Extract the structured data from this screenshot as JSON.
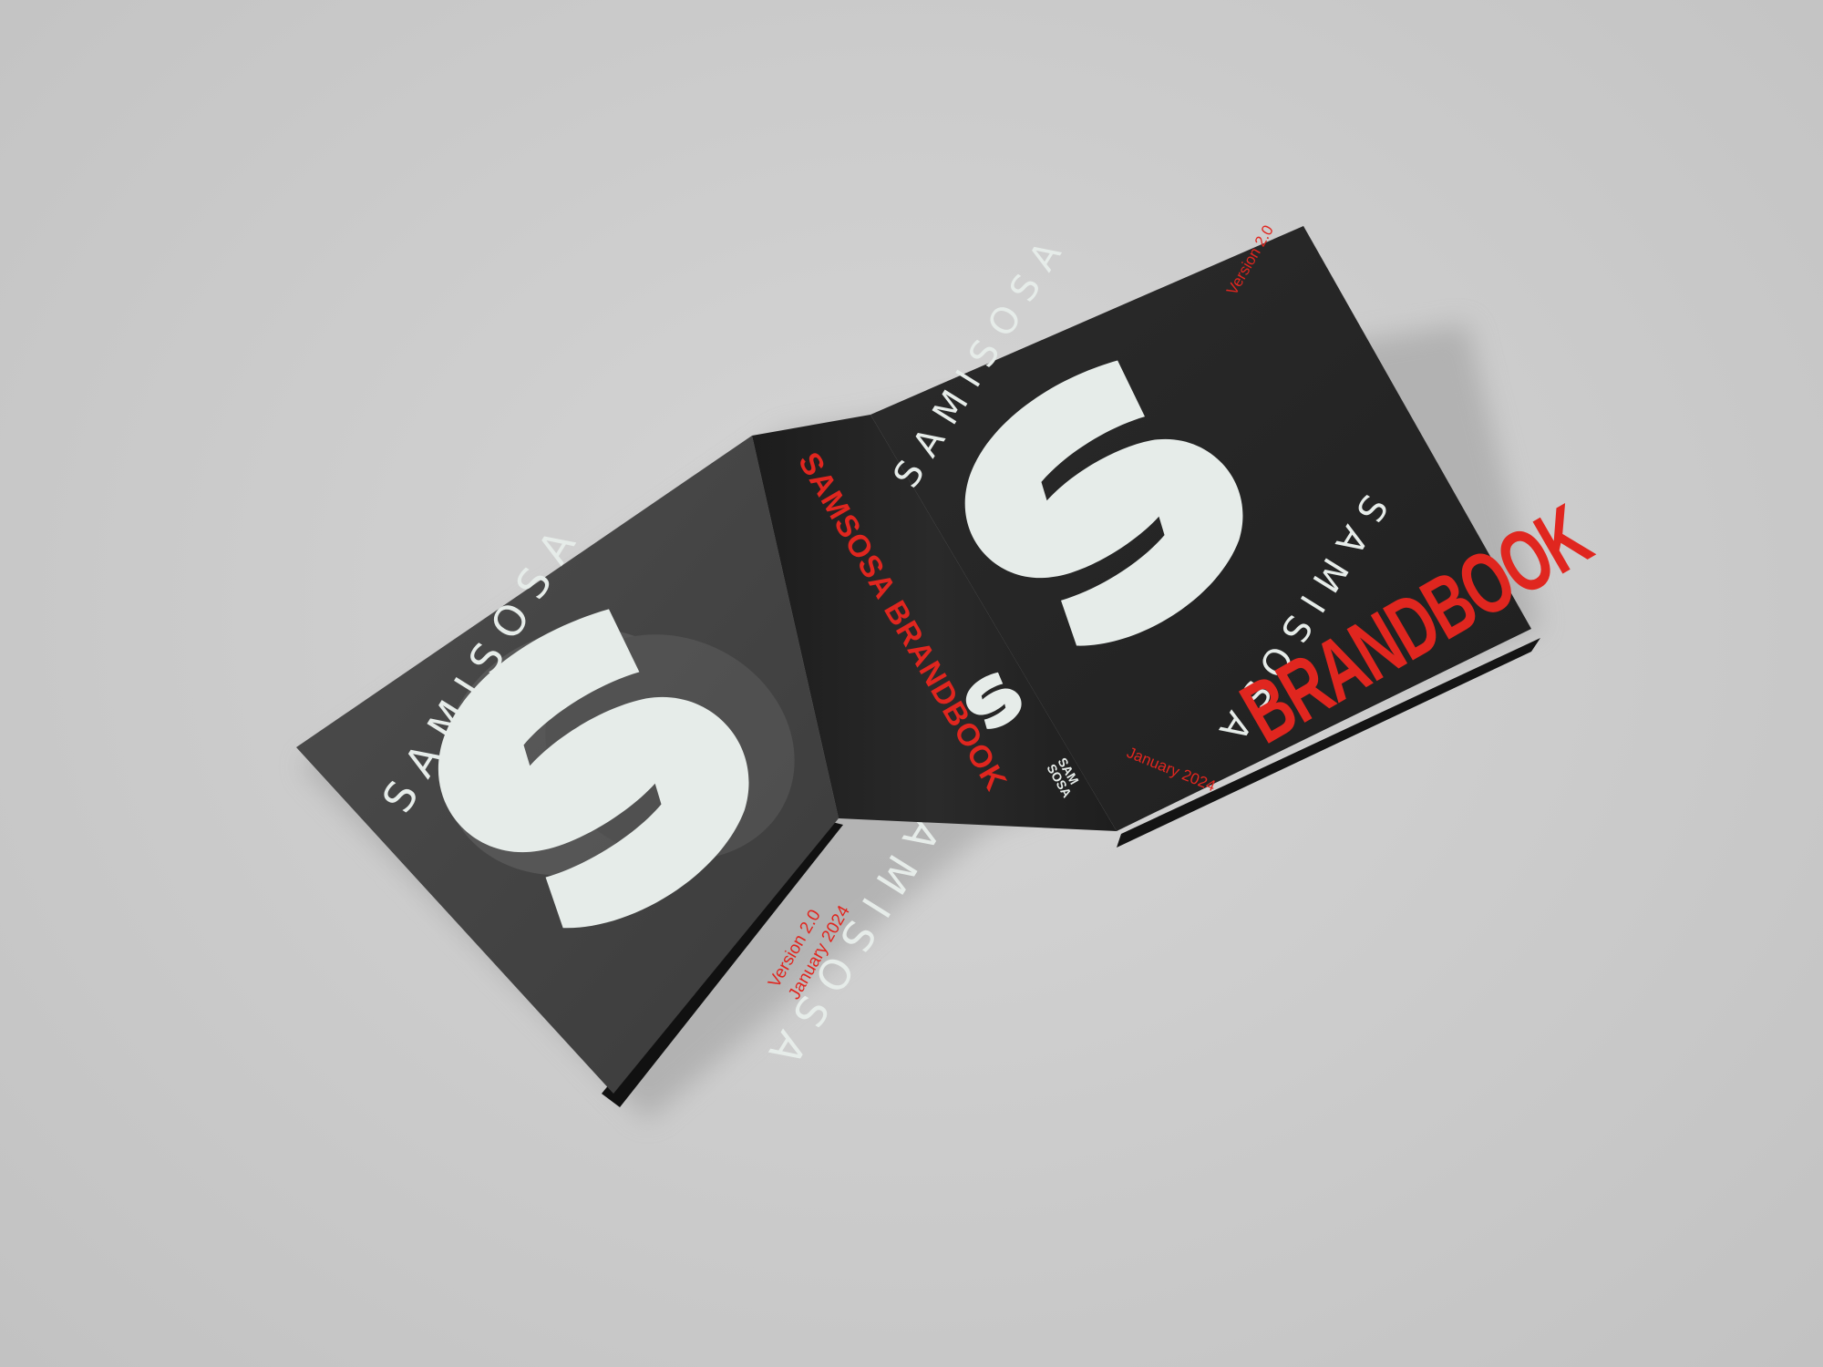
{
  "scene": {
    "description_type": "photo",
    "colors": {
      "background": "#cdcdcd",
      "cover_dark": "#262626",
      "cover_grey": "#4a4a4a",
      "logo_fill": "#e6ece9",
      "accent_red": "#e0261f"
    }
  },
  "back_cover": {
    "wordmark_top": "SAMISOSA",
    "wordmark_bottom": "SAMISOSA",
    "version": "Version 2.0",
    "date": "January 2024",
    "logo_icon": "s-monogram-icon"
  },
  "spine": {
    "title": "SAMSOSA BRANDBOOK",
    "tag_line1": "SAM",
    "tag_line2": "SOSA",
    "logo_icon": "s-monogram-icon"
  },
  "front_cover": {
    "wordmark_top": "SAMISOSA",
    "wordmark_bottom": "SAMISOSA",
    "version": "Version 2.0",
    "date": "January 2024",
    "title": "BRANDBOOK",
    "logo_icon": "s-monogram-icon"
  }
}
